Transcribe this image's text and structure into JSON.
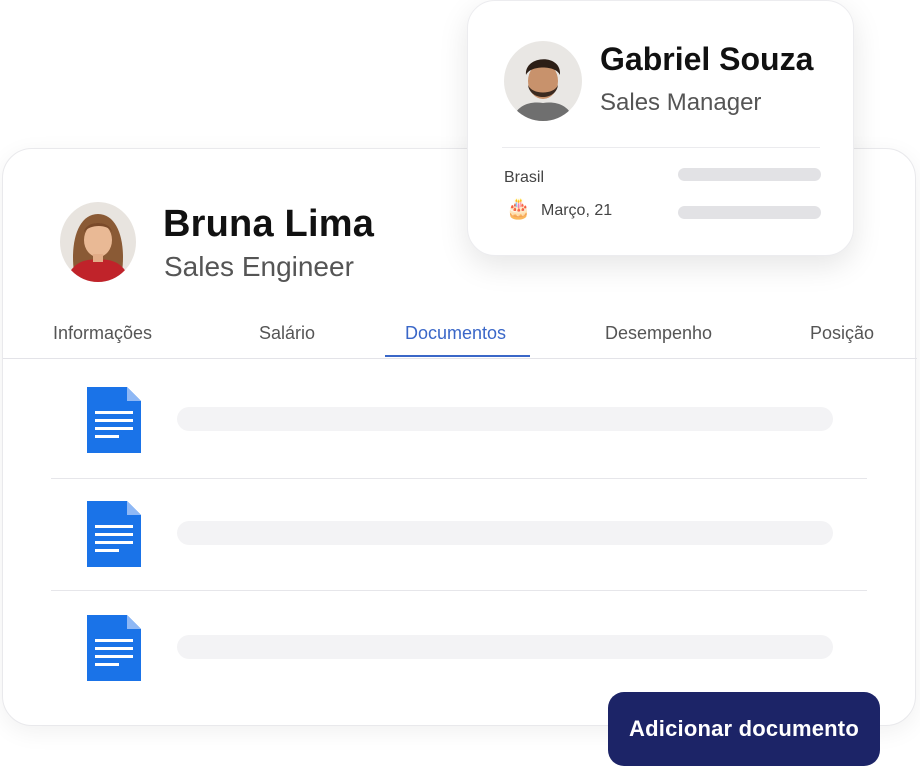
{
  "employee": {
    "name": "Bruna Lima",
    "role": "Sales Engineer"
  },
  "tabs": [
    {
      "label": "Informações"
    },
    {
      "label": "Salário"
    },
    {
      "label": "Documentos",
      "active": true
    },
    {
      "label": "Desempenho"
    },
    {
      "label": "Posição"
    }
  ],
  "documents": [
    {
      "icon": "document-icon"
    },
    {
      "icon": "document-icon"
    },
    {
      "icon": "document-icon"
    }
  ],
  "manager": {
    "name": "Gabriel Souza",
    "role": "Sales Manager",
    "country": "Brasil",
    "birthday": "Março, 21",
    "birthday_icon": "birthday-cake-icon"
  },
  "actions": {
    "add_document_label": "Adicionar documento"
  },
  "colors": {
    "accent": "#3a67c8",
    "button_bg": "#1c2467",
    "doc_icon": "#1a73e8"
  }
}
